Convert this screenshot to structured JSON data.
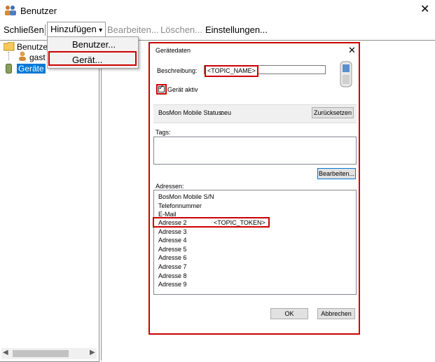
{
  "window": {
    "title": "Benutzer"
  },
  "menu": {
    "close": "Schließen",
    "add": "Hinzufügen",
    "add_arrow": "▾",
    "edit": "Bearbeiten...",
    "delete": "Löschen...",
    "settings": "Einstellungen..."
  },
  "dropdown": {
    "items": [
      "Benutzer...",
      "Gerät..."
    ]
  },
  "tree": {
    "users": "Benutzer",
    "user_gast": "gast",
    "devices": "Geräte"
  },
  "dialog": {
    "title": "Gerätedaten",
    "description_label": "Beschreibung:",
    "description_value": "<TOPIC_NAME>",
    "device_active_label": "Gerät aktiv",
    "device_active_checked": true,
    "status_label": "BosMon Mobile Status:",
    "status_value": "neu",
    "reset_button": "Zurücksetzen",
    "tags_label": "Tags:",
    "edit_button": "Bearbeiten...",
    "addresses_label": "Adressen:",
    "addresses": [
      {
        "name": "BosMon Mobile S/N",
        "value": ""
      },
      {
        "name": "Telefonnummer",
        "value": ""
      },
      {
        "name": "E-Mail",
        "value": ""
      },
      {
        "name": "Adresse 2",
        "value": "<TOPIC_TOKEN>"
      },
      {
        "name": "Adresse 3",
        "value": ""
      },
      {
        "name": "Adresse 4",
        "value": ""
      },
      {
        "name": "Adresse 5",
        "value": ""
      },
      {
        "name": "Adresse 6",
        "value": ""
      },
      {
        "name": "Adresse 7",
        "value": ""
      },
      {
        "name": "Adresse 8",
        "value": ""
      },
      {
        "name": "Adresse 9",
        "value": ""
      }
    ],
    "ok_button": "OK",
    "cancel_button": "Abbrechen"
  },
  "icons": {
    "app": "users-icon",
    "close": "close-icon",
    "folder": "folder-icon",
    "user": "user-icon",
    "device": "phone-icon",
    "checkbox": "checkmark-icon"
  },
  "colors": {
    "highlight": "#cc0000",
    "selection": "#0078d7"
  }
}
